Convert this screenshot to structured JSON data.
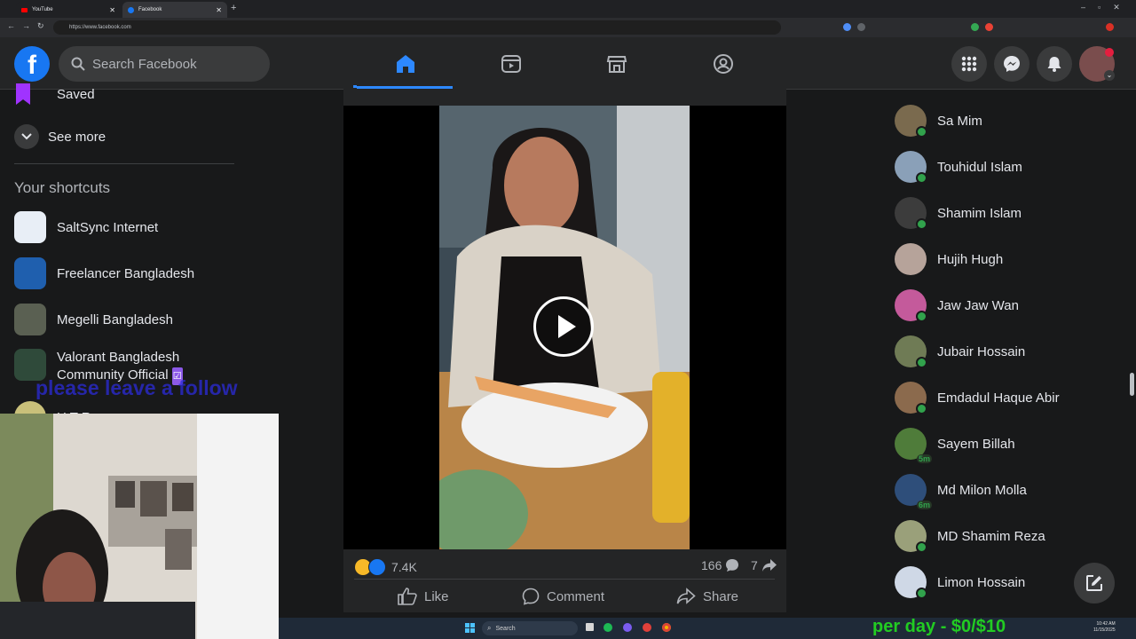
{
  "browser": {
    "tabs": [
      {
        "title": "YouTube",
        "favicon_color": "#ff0000"
      },
      {
        "title": "Facebook",
        "favicon_color": "#1877f2"
      }
    ],
    "url": "https://www.facebook.com"
  },
  "header": {
    "logo": "f",
    "search_placeholder": "Search Facebook"
  },
  "sidebar": {
    "saved": "Saved",
    "see_more": "See more",
    "shortcuts_title": "Your shortcuts",
    "shortcuts": [
      {
        "label": "SaltSync Internet"
      },
      {
        "label": "Freelancer Bangladesh"
      },
      {
        "label": "Megelli Bangladesh"
      },
      {
        "label": "Valorant Bangladesh",
        "label2": "Community Official",
        "badge": "☑"
      },
      {
        "label": "H T R gamers"
      }
    ]
  },
  "stream_overlay": {
    "follow_text": "please leave a follow",
    "price_text": "per day - $0/$10"
  },
  "post": {
    "reactions_count": "7.4K",
    "comments_count": "166",
    "shares_count": "7",
    "actions": {
      "like": "Like",
      "comment": "Comment",
      "share": "Share"
    }
  },
  "contacts": [
    {
      "name": "Sa Mim",
      "online": true,
      "color": "#7a6a4e"
    },
    {
      "name": "Touhidul Islam",
      "online": true,
      "color": "#8aa0b8"
    },
    {
      "name": "Shamim Islam",
      "online": true,
      "color": "#3c3c3c"
    },
    {
      "name": "Hujih Hugh",
      "online": false,
      "color": "#b6a39a"
    },
    {
      "name": "Jaw Jaw Wan",
      "online": true,
      "color": "#c45a9b"
    },
    {
      "name": "Jubair Hossain",
      "online": true,
      "color": "#6f7b55"
    },
    {
      "name": "Emdadul Haque Abir",
      "online": true,
      "color": "#8b6a4d"
    },
    {
      "name": "Sayem Billah",
      "online": false,
      "minutes": "5m",
      "color": "#4f7c3a"
    },
    {
      "name": "Md Milon Molla",
      "online": false,
      "minutes": "6m",
      "color": "#2e4e7a"
    },
    {
      "name": "MD Shamim Reza",
      "online": true,
      "color": "#9aa07a"
    },
    {
      "name": "Limon Hossain",
      "online": true,
      "color": "#cfd8e6"
    }
  ],
  "taskbar": {
    "search": "Search",
    "time": "10:42 AM",
    "date": "11/15/2025"
  },
  "colors": {
    "accent": "#1877f2",
    "online": "#31a24c"
  }
}
